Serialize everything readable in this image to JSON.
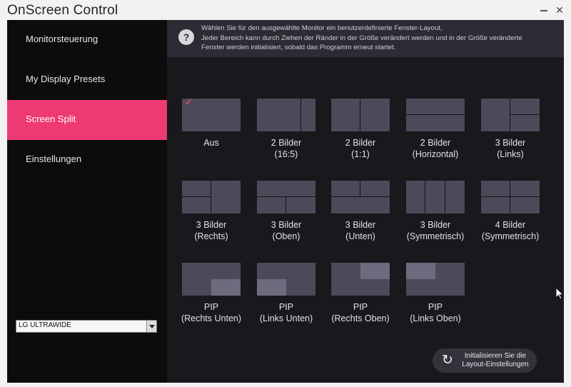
{
  "window": {
    "title": "OnScreen Control"
  },
  "titlebar_buttons": {
    "minimize": "–",
    "close": "✕"
  },
  "sidebar": {
    "items": [
      {
        "label": "Monitorsteuerung",
        "active": false
      },
      {
        "label": "My Display Presets",
        "active": false
      },
      {
        "label": "Screen Split",
        "active": true
      },
      {
        "label": "Einstellungen",
        "active": false
      }
    ],
    "monitor_select": {
      "value": "LG ULTRAWIDE"
    }
  },
  "info": {
    "icon": "?",
    "lines": [
      "Wählen Sie für den ausgewählte Monitor ein benutzerdefinierte Fenster-Layout,",
      "Jeder Bereich kann durch Ziehen der Ränder in der Größe verändert werden und in der Größe veränderte",
      "Fenster werden initialisiert, sobald das Programm erneut startet."
    ]
  },
  "layouts": [
    {
      "id": "aus",
      "line1": "Aus",
      "line2": "",
      "selected": true
    },
    {
      "id": "2-16-5",
      "line1": "2 Bilder",
      "line2": "(16:5)",
      "selected": false
    },
    {
      "id": "2-1-1",
      "line1": "2 Bilder",
      "line2": "(1:1)",
      "selected": false
    },
    {
      "id": "2-horizontal",
      "line1": "2 Bilder",
      "line2": "(Horizontal)",
      "selected": false
    },
    {
      "id": "3-links",
      "line1": "3 Bilder",
      "line2": "(Links)",
      "selected": false
    },
    {
      "id": "3-rechts",
      "line1": "3 Bilder",
      "line2": "(Rechts)",
      "selected": false
    },
    {
      "id": "3-oben",
      "line1": "3 Bilder",
      "line2": "(Oben)",
      "selected": false
    },
    {
      "id": "3-unten",
      "line1": "3 Bilder",
      "line2": "(Unten)",
      "selected": false
    },
    {
      "id": "3-symmetrisch",
      "line1": "3 Bilder",
      "line2": "(Symmetrisch)",
      "selected": false
    },
    {
      "id": "4-symmetrisch",
      "line1": "4 Bilder",
      "line2": "(Symmetrisch)",
      "selected": false
    },
    {
      "id": "pip-rechts-unten",
      "line1": "PIP",
      "line2": "(Rechts Unten)",
      "selected": false
    },
    {
      "id": "pip-links-unten",
      "line1": "PIP",
      "line2": "(Links Unten)",
      "selected": false
    },
    {
      "id": "pip-rechts-oben",
      "line1": "PIP",
      "line2": "(Rechts Oben)",
      "selected": false
    },
    {
      "id": "pip-links-oben",
      "line1": "PIP",
      "line2": "(Links Oben)",
      "selected": false
    }
  ],
  "reset_button": {
    "line1": "Initialisieren Sie die",
    "line2": "Layout-Einstellungen",
    "icon": "refresh-icon"
  },
  "colors": {
    "accent": "#ee3a73",
    "sidebar_bg": "#0c0c0c",
    "main_bg": "#18181d",
    "tile": "#4a4a58"
  }
}
